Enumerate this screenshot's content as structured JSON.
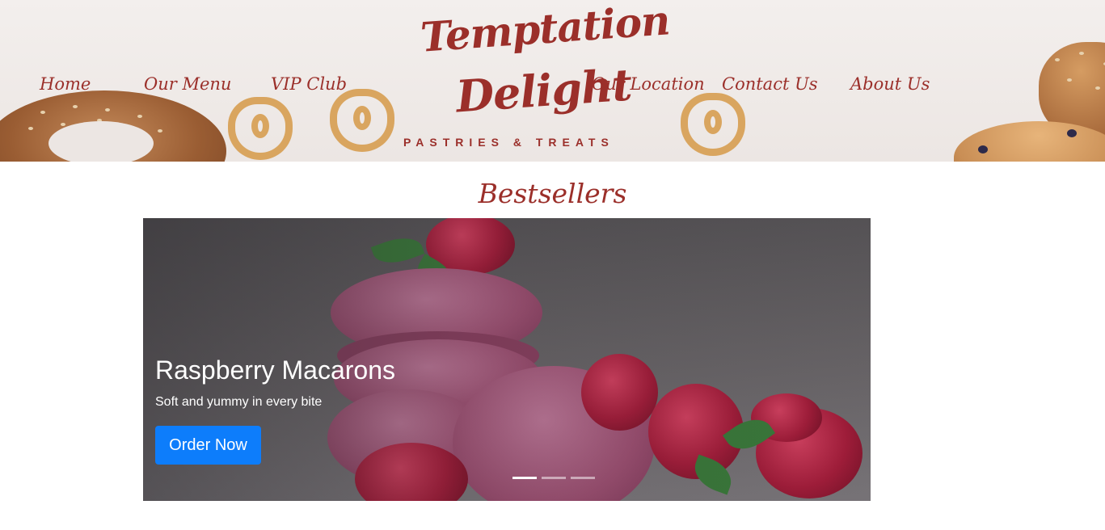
{
  "header": {
    "nav_left": [
      {
        "label": "Home"
      },
      {
        "label": "Our Menu"
      },
      {
        "label": "VIP Club"
      }
    ],
    "nav_right": [
      {
        "label": "Our Location"
      },
      {
        "label": "Contact Us"
      },
      {
        "label": "About Us"
      }
    ],
    "logo": {
      "line1": "Temptation",
      "line2": "Delight",
      "tagline": "PASTRIES & TREATS"
    }
  },
  "bestsellers": {
    "title": "Bestsellers",
    "slide": {
      "title": "Raspberry Macarons",
      "text": "Soft and yummy in every bite",
      "button": "Order Now"
    },
    "indicators": {
      "count": 3,
      "active_index": 0
    }
  },
  "colors": {
    "brand": "#9b2f2a",
    "button": "#0d7dfb"
  }
}
